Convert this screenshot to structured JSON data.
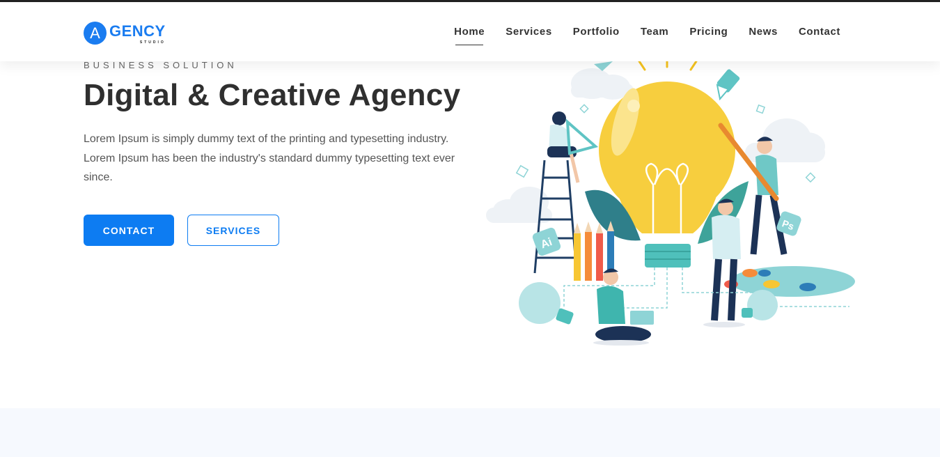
{
  "brand": {
    "badge_letter": "A",
    "word": "GENCY",
    "sub": "STUDIO",
    "color": "#1a7cf0"
  },
  "nav": {
    "items": [
      {
        "label": "Home",
        "active": true
      },
      {
        "label": "Services"
      },
      {
        "label": "Portfolio"
      },
      {
        "label": "Team"
      },
      {
        "label": "Pricing"
      },
      {
        "label": "News"
      },
      {
        "label": "Contact"
      }
    ]
  },
  "hero": {
    "kicker": "BUSINESS SOLUTION",
    "title": "Digital & Creative Agency",
    "text": "Lorem Ipsum is simply dummy text of the printing and typesetting industry. Lorem Ipsum has been the industry's standard dummy typesetting text ever since.",
    "primary_button": "CONTACT",
    "secondary_button": "SERVICES",
    "accent_color": "#0d7cf2"
  },
  "illustration": {
    "icon_labels": [
      "Ai",
      "Ps"
    ]
  }
}
